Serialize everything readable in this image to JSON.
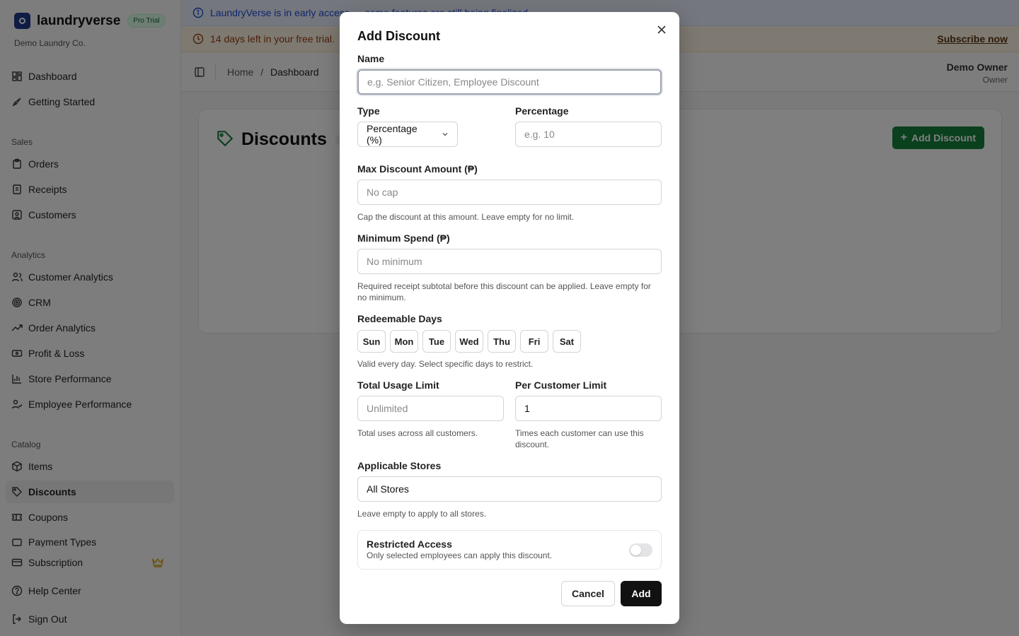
{
  "sidebar": {
    "brand": "laundryverse",
    "badge": "Pro Trial",
    "org": "Demo Laundry Co.",
    "items_top": [
      {
        "label": "Dashboard",
        "icon": "grid-icon"
      },
      {
        "label": "Getting Started",
        "icon": "rocket-icon"
      }
    ],
    "sections": {
      "sales": "Sales",
      "analytics": "Analytics",
      "catalog": "Catalog"
    },
    "sales_items": [
      {
        "label": "Orders",
        "icon": "clipboard-icon"
      },
      {
        "label": "Receipts",
        "icon": "receipt-icon"
      },
      {
        "label": "Customers",
        "icon": "user-square-icon"
      }
    ],
    "analytics_items": [
      {
        "label": "Customer Analytics",
        "icon": "users-icon"
      },
      {
        "label": "CRM",
        "icon": "target-icon"
      },
      {
        "label": "Order Analytics",
        "icon": "trend-up-icon"
      },
      {
        "label": "Profit & Loss",
        "icon": "cash-icon"
      },
      {
        "label": "Store Performance",
        "icon": "bar-chart-icon"
      },
      {
        "label": "Employee Performance",
        "icon": "user-check-icon"
      }
    ],
    "catalog_items": [
      {
        "label": "Items",
        "icon": "package-icon"
      },
      {
        "label": "Discounts",
        "icon": "tag-icon"
      },
      {
        "label": "Coupons",
        "icon": "ticket-icon"
      },
      {
        "label": "Payment Types",
        "icon": "wallet-icon"
      }
    ],
    "bottom_items": [
      {
        "label": "Subscription",
        "icon": "card-icon"
      },
      {
        "label": "Help Center",
        "icon": "help-icon"
      },
      {
        "label": "Sign Out",
        "icon": "sign-out-icon"
      }
    ]
  },
  "banners": {
    "info": "LaundryVerse is in early access — some features are still being finalized.",
    "trial": "14 days left in your free trial.",
    "subscribe": "Subscribe now"
  },
  "topbar": {
    "crumb_home": "Home",
    "crumb_sep": "/",
    "crumb_current": "Dashboard",
    "user_name": "Demo Owner",
    "user_role": "Owner"
  },
  "page": {
    "title": "Discounts",
    "count": "0",
    "add_button": "Add Discount"
  },
  "modal": {
    "title": "Add Discount",
    "name_label": "Name",
    "name_placeholder": "e.g. Senior Citizen, Employee Discount",
    "type_label": "Type",
    "type_value": "Percentage (%)",
    "percentage_label": "Percentage",
    "percentage_placeholder": "e.g. 10",
    "max_label": "Max Discount Amount (₱)",
    "max_placeholder": "No cap",
    "max_hint": "Cap the discount at this amount. Leave empty for no limit.",
    "min_label": "Minimum Spend (₱)",
    "min_placeholder": "No minimum",
    "min_hint": "Required receipt subtotal before this discount can be applied. Leave empty for no minimum.",
    "days_label": "Redeemable Days",
    "days": [
      "Sun",
      "Mon",
      "Tue",
      "Wed",
      "Thu",
      "Fri",
      "Sat"
    ],
    "days_hint": "Valid every day. Select specific days to restrict.",
    "total_label": "Total Usage Limit",
    "total_placeholder": "Unlimited",
    "total_hint": "Total uses across all customers.",
    "per_label": "Per Customer Limit",
    "per_value": "1",
    "per_hint": "Times each customer can use this discount.",
    "stores_label": "Applicable Stores",
    "stores_value": "All Stores",
    "stores_hint": "Leave empty to apply to all stores.",
    "restricted_title": "Restricted Access",
    "restricted_desc": "Only selected employees can apply this discount.",
    "restricted_on": false,
    "cancel": "Cancel",
    "add": "Add"
  },
  "colors": {
    "accent_green": "#15803d",
    "primary_dark": "#111111",
    "info_blue": "#1d4ed8",
    "warning_brown": "#92400e"
  }
}
